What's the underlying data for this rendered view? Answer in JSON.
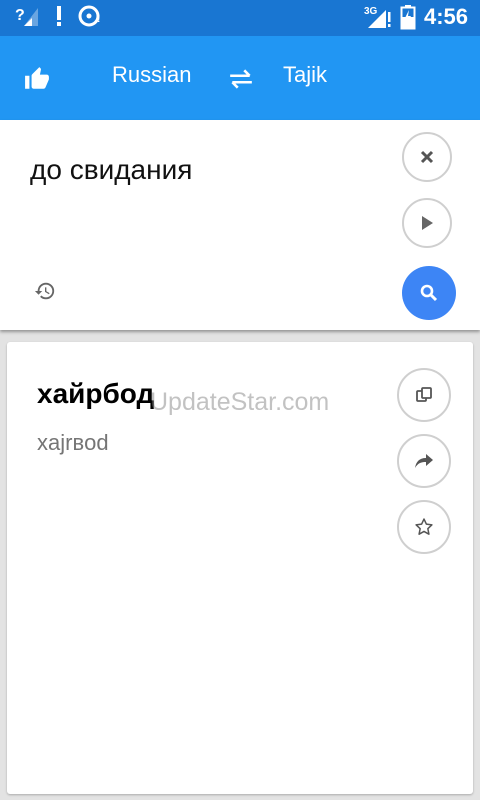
{
  "statusbar": {
    "network": "3G",
    "time": "4:56"
  },
  "appbar": {
    "like_icon": "thumbs-up-icon",
    "source_language": "Russian",
    "swap_icon": "swap-arrows-icon",
    "target_language": "Tajik"
  },
  "input": {
    "text": "до свидания",
    "clear_icon": "close-icon",
    "play_icon": "play-icon",
    "search_icon": "search-icon",
    "history_icon": "history-icon"
  },
  "result": {
    "translation": "хайрбод",
    "transliteration": "xajrвod",
    "copy_icon": "copy-icon",
    "share_icon": "share-icon",
    "favorite_icon": "star-icon"
  },
  "watermark": "UpdateStar.com",
  "colors": {
    "status_bar": "#1976d2",
    "app_bar": "#2196f3",
    "search_button": "#3d85f5",
    "background": "#e3e3e3"
  }
}
